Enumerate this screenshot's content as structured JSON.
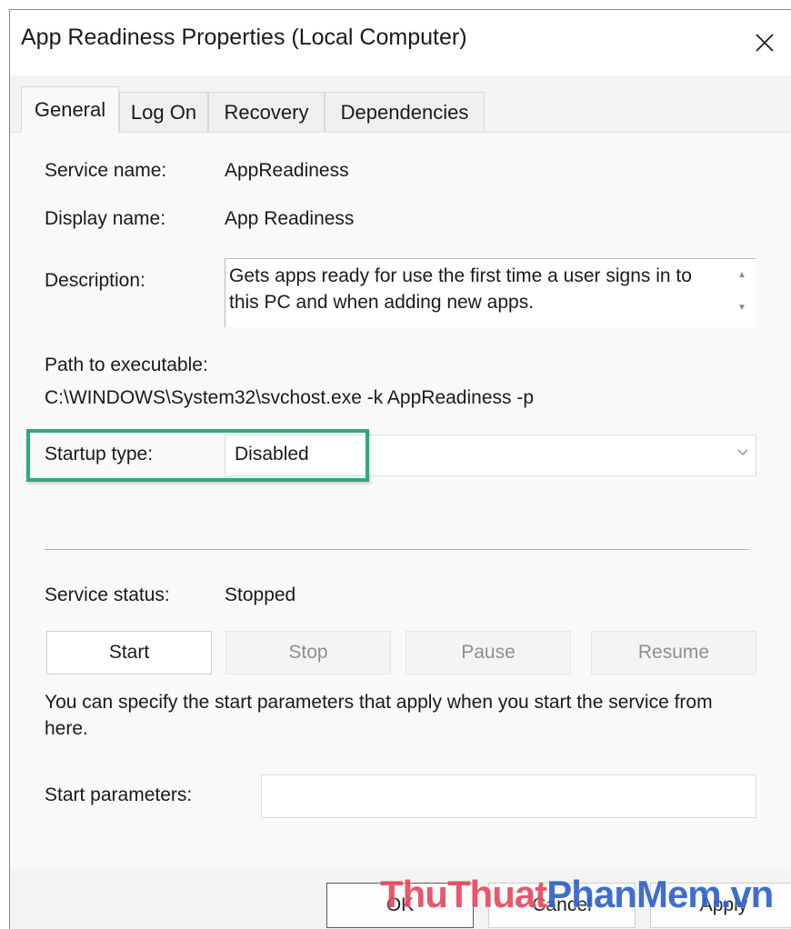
{
  "window": {
    "title": "App Readiness Properties (Local Computer)"
  },
  "tabs": [
    {
      "label": "General",
      "active": true
    },
    {
      "label": "Log On",
      "active": false
    },
    {
      "label": "Recovery",
      "active": false
    },
    {
      "label": "Dependencies",
      "active": false
    }
  ],
  "general": {
    "service_name_label": "Service name:",
    "service_name_value": "AppReadiness",
    "display_name_label": "Display name:",
    "display_name_value": "App Readiness",
    "description_label": "Description:",
    "description_value": "Gets apps ready for use the first time a user signs in to this PC and when adding new apps.",
    "path_label": "Path to executable:",
    "path_value": "C:\\WINDOWS\\System32\\svchost.exe -k AppReadiness -p",
    "startup_type_label": "Startup type:",
    "startup_type_value": "Disabled",
    "service_status_label": "Service status:",
    "service_status_value": "Stopped",
    "buttons": {
      "start": "Start",
      "stop": "Stop",
      "pause": "Pause",
      "resume": "Resume"
    },
    "note": "You can specify the start parameters that apply when you start the service from here.",
    "start_params_label": "Start parameters:",
    "start_params_value": ""
  },
  "footer": {
    "ok": "OK",
    "cancel": "Cancel",
    "apply": "Apply"
  },
  "watermark": {
    "part1": "ThuThuat",
    "part2": "PhanMem",
    "part3": ".vn"
  },
  "icons": {
    "close": "close-icon",
    "dropdown": "chevron-down-icon",
    "scroll_up": "scroll-up-arrow-icon",
    "scroll_down": "scroll-down-arrow-icon"
  },
  "colors": {
    "highlight_border": "#2ea882",
    "watermark_red": "#e84a5f",
    "watermark_blue": "#2f63c8"
  }
}
